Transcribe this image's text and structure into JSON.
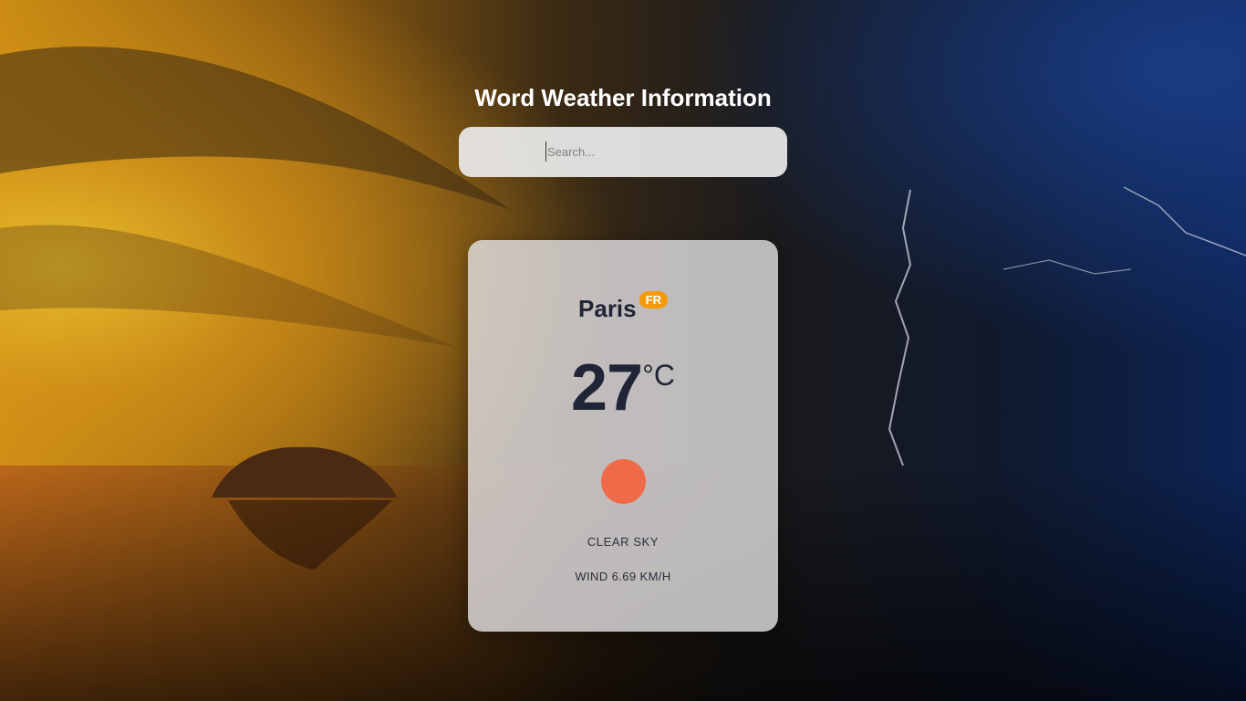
{
  "header": {
    "title": "Word Weather Information"
  },
  "search": {
    "placeholder": "Search..."
  },
  "weather": {
    "city": "Paris",
    "country_code": "FR",
    "temperature": "27",
    "unit": "°C",
    "condition_icon": "sun-icon",
    "description": "CLEAR SKY",
    "wind": "WIND 6.69 KM/H"
  },
  "colors": {
    "badge": "#f59a0b",
    "sun": "#ef6a48",
    "text_dark": "#1f2436"
  }
}
